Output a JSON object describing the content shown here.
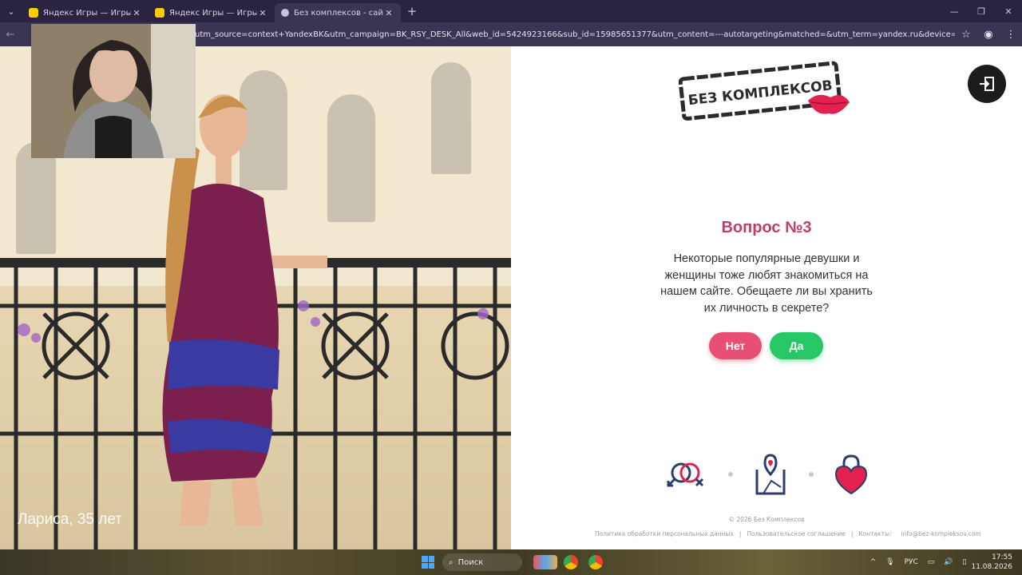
{
  "browser": {
    "tabs": [
      {
        "title": "Яндекс Игры — Игры онлайн",
        "active": false,
        "favicon": "yandex-games-icon"
      },
      {
        "title": "Яндекс Игры — Игры онлайн",
        "active": false,
        "favicon": "yandex-games-icon"
      },
      {
        "title": "Без комплексов - сайт онлайн",
        "active": true,
        "favicon": "site-icon"
      }
    ],
    "url": "utm_source=context+YandexBK&utm_campaign=BK_RSY_DESK_All&web_id=5424923166&sub_id=15985651377&utm_content=---autotargeting&matched=&utm_term=yandex.ru&device=desktop&region=Москва&phrase_id=..."
  },
  "photo": {
    "caption": "Лариса, 35 лет"
  },
  "logo": {
    "text": "БЕЗ КОМПЛЕКСОВ"
  },
  "quiz": {
    "title": "Вопрос №3",
    "text": "Некоторые популярные девушки и женщины тоже любят знакомиться на нашем сайте. Обещаете ли вы хранить их личность в секрете?",
    "no_label": "Нет",
    "yes_label": "Да"
  },
  "features": [
    "couple-icon",
    "map-pin-icon",
    "heart-lock-icon"
  ],
  "footer": {
    "copyright": "© 2026 Без Комплексов",
    "privacy": "Политика обработки персональных данных",
    "terms": "Пользовательское соглашение",
    "contacts_label": "Контакты:",
    "email": "info@bez-kompleksov.com"
  },
  "taskbar": {
    "search_label": "Поиск",
    "lang": "РУС",
    "time": "17:55",
    "date": "11.08.2026"
  },
  "colors": {
    "accent": "#c23c6e",
    "no_button": "#e94f74",
    "yes_button": "#27c766"
  }
}
